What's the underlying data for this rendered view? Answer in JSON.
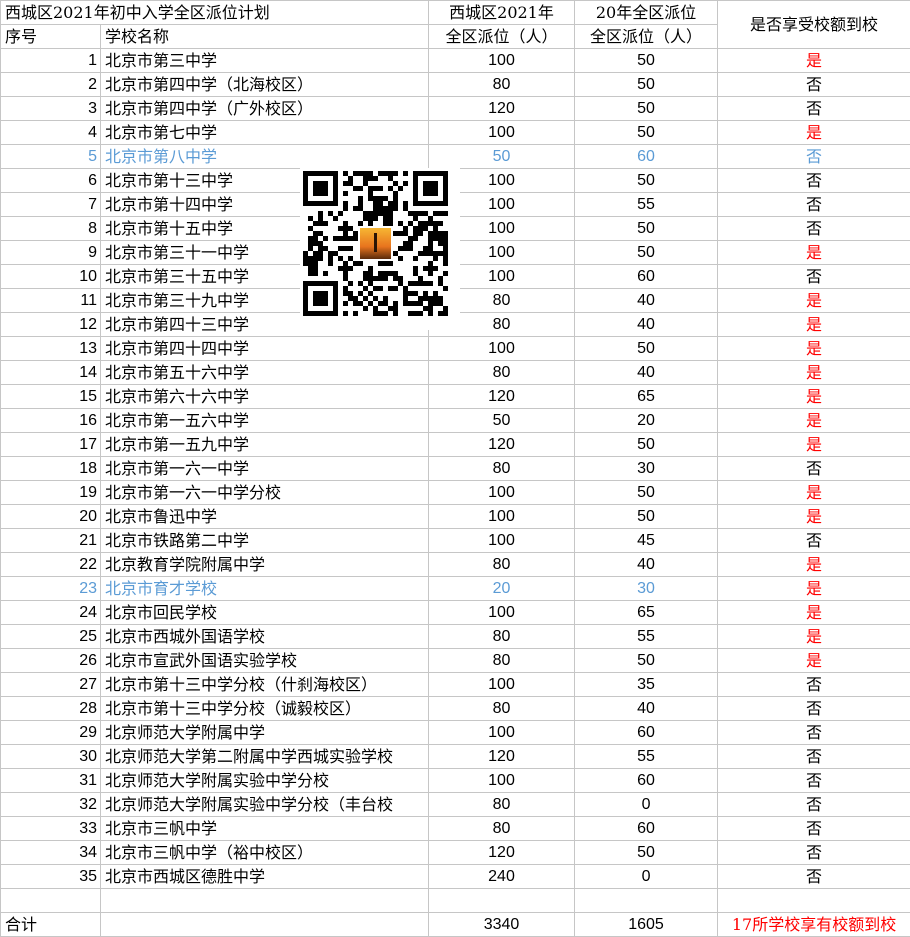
{
  "header": {
    "title": "西城区2021年初中入学全区派位计划",
    "col_index": "序号",
    "col_school": "学校名称",
    "col_2021_line1": "西城区2021年",
    "col_2021_line2": "全区派位（人）",
    "col_2020_line1": "20年全区派位",
    "col_2020_line2": "全区派位（人）",
    "col_quota": "是否享受校额到校"
  },
  "rows": [
    {
      "idx": "1",
      "name": "北京市第三中学",
      "a": "100",
      "b": "50",
      "flag": "是"
    },
    {
      "idx": "2",
      "name": "北京市第四中学（北海校区）",
      "a": "80",
      "b": "50",
      "flag": "否"
    },
    {
      "idx": "3",
      "name": "北京市第四中学（广外校区）",
      "a": "120",
      "b": "50",
      "flag": "否"
    },
    {
      "idx": "4",
      "name": "北京市第七中学",
      "a": "100",
      "b": "50",
      "flag": "是"
    },
    {
      "idx": "5",
      "name": "北京市第八中学",
      "a": "50",
      "b": "60",
      "flag": "否"
    },
    {
      "idx": "6",
      "name": "北京市第十三中学",
      "a": "100",
      "b": "50",
      "flag": "否"
    },
    {
      "idx": "7",
      "name": "北京市第十四中学",
      "a": "100",
      "b": "55",
      "flag": "否"
    },
    {
      "idx": "8",
      "name": "北京市第十五中学",
      "a": "100",
      "b": "50",
      "flag": "否"
    },
    {
      "idx": "9",
      "name": "北京市第三十一中学",
      "a": "100",
      "b": "50",
      "flag": "是"
    },
    {
      "idx": "10",
      "name": "北京市第三十五中学",
      "a": "100",
      "b": "60",
      "flag": "否"
    },
    {
      "idx": "11",
      "name": "北京市第三十九中学",
      "a": "80",
      "b": "40",
      "flag": "是"
    },
    {
      "idx": "12",
      "name": "北京市第四十三中学",
      "a": "80",
      "b": "40",
      "flag": "是"
    },
    {
      "idx": "13",
      "name": "北京市第四十四中学",
      "a": "100",
      "b": "50",
      "flag": "是"
    },
    {
      "idx": "14",
      "name": "北京市第五十六中学",
      "a": "80",
      "b": "40",
      "flag": "是"
    },
    {
      "idx": "15",
      "name": "北京市第六十六中学",
      "a": "120",
      "b": "65",
      "flag": "是"
    },
    {
      "idx": "16",
      "name": "北京市第一五六中学",
      "a": "50",
      "b": "20",
      "flag": "是"
    },
    {
      "idx": "17",
      "name": "北京市第一五九中学",
      "a": "120",
      "b": "50",
      "flag": "是"
    },
    {
      "idx": "18",
      "name": "北京市第一六一中学",
      "a": "80",
      "b": "30",
      "flag": "否"
    },
    {
      "idx": "19",
      "name": "北京市第一六一中学分校",
      "a": "100",
      "b": "50",
      "flag": "是"
    },
    {
      "idx": "20",
      "name": "北京市鲁迅中学",
      "a": "100",
      "b": "50",
      "flag": "是"
    },
    {
      "idx": "21",
      "name": "北京市铁路第二中学",
      "a": "100",
      "b": "45",
      "flag": "否"
    },
    {
      "idx": "22",
      "name": "北京教育学院附属中学",
      "a": "80",
      "b": "40",
      "flag": "是"
    },
    {
      "idx": "23",
      "name": "北京市育才学校",
      "a": "20",
      "b": "30",
      "flag": "是"
    },
    {
      "idx": "24",
      "name": "北京市回民学校",
      "a": "100",
      "b": "65",
      "flag": "是"
    },
    {
      "idx": "25",
      "name": "北京市西城外国语学校",
      "a": "80",
      "b": "55",
      "flag": "是"
    },
    {
      "idx": "26",
      "name": "北京市宣武外国语实验学校",
      "a": "80",
      "b": "50",
      "flag": "是"
    },
    {
      "idx": "27",
      "name": "北京市第十三中学分校（什刹海校区）",
      "a": "100",
      "b": "35",
      "flag": "否"
    },
    {
      "idx": "28",
      "name": "北京市第十三中学分校（诚毅校区）",
      "a": "80",
      "b": "40",
      "flag": "否"
    },
    {
      "idx": "29",
      "name": "北京师范大学附属中学",
      "a": "100",
      "b": "60",
      "flag": "否"
    },
    {
      "idx": "30",
      "name": "北京师范大学第二附属中学西城实验学校",
      "a": "120",
      "b": "55",
      "flag": "否"
    },
    {
      "idx": "31",
      "name": "北京师范大学附属实验中学分校",
      "a": "100",
      "b": "60",
      "flag": "否"
    },
    {
      "idx": "32",
      "name": "北京师范大学附属实验中学分校（丰台校",
      "a": "80",
      "b": "0",
      "flag": "否"
    },
    {
      "idx": "33",
      "name": "北京市三帆中学",
      "a": "80",
      "b": "60",
      "flag": "否"
    },
    {
      "idx": "34",
      "name": "北京市三帆中学（裕中校区）",
      "a": "120",
      "b": "50",
      "flag": "否"
    },
    {
      "idx": "35",
      "name": "北京市西城区德胜中学",
      "a": "240",
      "b": "0",
      "flag": "否"
    }
  ],
  "footer": {
    "label": "合计",
    "total_2021": "3340",
    "total_2020": "1605",
    "note": "17所学校享有校额到校"
  },
  "colors": {
    "yes": "#ff0000",
    "highlight": "#5b9bd5",
    "grid": "#c6c6c6"
  },
  "highlight_rows": [
    "5",
    "23"
  ]
}
